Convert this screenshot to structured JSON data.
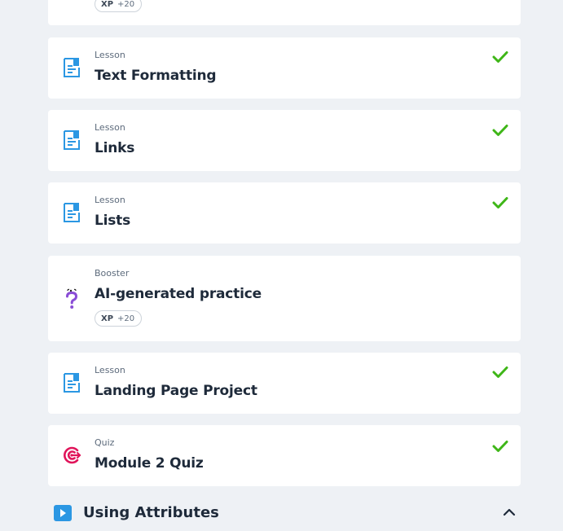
{
  "top_card": {
    "xp_label": "XP",
    "xp_value": "+20"
  },
  "items": [
    {
      "kind": "Lesson",
      "title": "Text Formatting",
      "icon": "lesson-doc-icon",
      "completed": true
    },
    {
      "kind": "Lesson",
      "title": "Links",
      "icon": "lesson-doc-icon",
      "completed": true
    },
    {
      "kind": "Lesson",
      "title": "Lists",
      "icon": "lesson-doc-icon",
      "completed": true
    },
    {
      "kind": "Booster",
      "title": "AI-generated practice",
      "icon": "question-mark-icon",
      "completed": false,
      "xp_label": "XP",
      "xp_value": "+20"
    },
    {
      "kind": "Lesson",
      "title": "Landing Page Project",
      "icon": "lesson-doc-icon",
      "completed": true
    },
    {
      "kind": "Quiz",
      "title": "Module 2 Quiz",
      "icon": "target-icon",
      "completed": true
    }
  ],
  "next_section": {
    "title": "Using Attributes",
    "icon": "play-icon",
    "expanded": true
  },
  "colors": {
    "background": "#eef1f5",
    "card": "#ffffff",
    "check": "#3fb618",
    "lesson_icon": "#2b97e3",
    "booster_icon": "#8a4dd6",
    "quiz_icon": "#e0145a"
  }
}
